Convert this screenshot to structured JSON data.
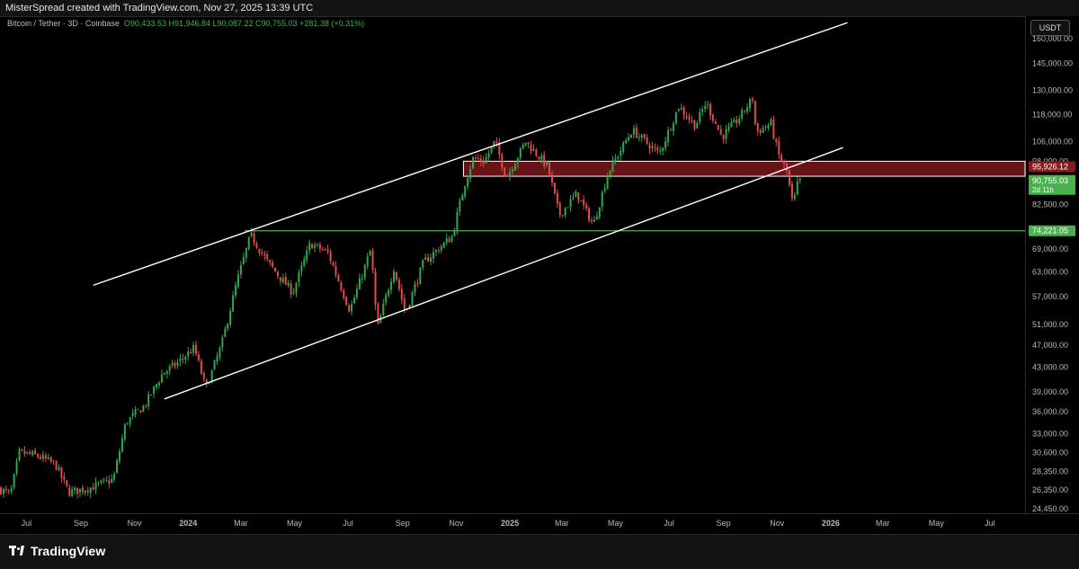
{
  "header": {
    "attribution": "MisterSpread created with TradingView.com, Nov 27, 2025 13:39 UTC",
    "symbol": "Bitcoin / Tether · 3D · Coinbase",
    "ohlc": "O90,433.53 H91,946.84 L90,087.22 C90,755.03 +281.38 (+0.31%)",
    "currency": "USDT"
  },
  "footer": {
    "brand": "TradingView"
  },
  "colors": {
    "up": "#2fa84f",
    "down": "#e04b4b",
    "zone": "#8a1a1f",
    "support": "#4caf50",
    "channel": "#ffffff",
    "axis_text": "#b9b9b9"
  },
  "chart_data": {
    "type": "line",
    "subtype": "candlestick with drawn channel",
    "title": "",
    "xlabel": "",
    "ylabel": "",
    "y_scale": "log",
    "ylim": [
      24000,
      175000
    ],
    "xlim": [
      "2023-06-01",
      "2026-08-10"
    ],
    "x_ticks": [
      {
        "date": "2023-07-01",
        "label": "Jul"
      },
      {
        "date": "2023-09-01",
        "label": "Sep"
      },
      {
        "date": "2023-11-01",
        "label": "Nov"
      },
      {
        "date": "2024-01-01",
        "label": "2024"
      },
      {
        "date": "2024-03-01",
        "label": "Mar"
      },
      {
        "date": "2024-05-01",
        "label": "May"
      },
      {
        "date": "2024-07-01",
        "label": "Jul"
      },
      {
        "date": "2024-09-01",
        "label": "Sep"
      },
      {
        "date": "2024-11-01",
        "label": "Nov"
      },
      {
        "date": "2025-01-01",
        "label": "2025"
      },
      {
        "date": "2025-03-01",
        "label": "Mar"
      },
      {
        "date": "2025-05-01",
        "label": "May"
      },
      {
        "date": "2025-07-01",
        "label": "Jul"
      },
      {
        "date": "2025-09-01",
        "label": "Sep"
      },
      {
        "date": "2025-11-01",
        "label": "Nov"
      },
      {
        "date": "2026-01-01",
        "label": "2026"
      },
      {
        "date": "2026-03-01",
        "label": "Mar"
      },
      {
        "date": "2026-05-01",
        "label": "May"
      },
      {
        "date": "2026-07-01",
        "label": "Jul"
      }
    ],
    "y_ticks": [
      {
        "value": 160000,
        "label": "160,000.00"
      },
      {
        "value": 145000,
        "label": "145,000.00"
      },
      {
        "value": 130000,
        "label": "130,000.00"
      },
      {
        "value": 118000,
        "label": "118,000.00"
      },
      {
        "value": 106000,
        "label": "106,000.00"
      },
      {
        "value": 98000,
        "label": "98,000.00"
      },
      {
        "value": 82500,
        "label": "82,500.00"
      },
      {
        "value": 69000,
        "label": "69,000.00"
      },
      {
        "value": 63000,
        "label": "63,000.00"
      },
      {
        "value": 57000,
        "label": "57,000.00"
      },
      {
        "value": 51000,
        "label": "51,000.00"
      },
      {
        "value": 47000,
        "label": "47,000.00"
      },
      {
        "value": 43000,
        "label": "43,000.00"
      },
      {
        "value": 39000,
        "label": "39,000.00"
      },
      {
        "value": 36000,
        "label": "36,000.00"
      },
      {
        "value": 33000,
        "label": "33,000.00"
      },
      {
        "value": 30600,
        "label": "30,600.00"
      },
      {
        "value": 28350,
        "label": "28,350.00"
      },
      {
        "value": 26350,
        "label": "26,350.00"
      },
      {
        "value": 24450,
        "label": "24,450.00"
      }
    ],
    "price_labels": [
      {
        "value": 95926.12,
        "label": "95,926.12",
        "style": "zone"
      },
      {
        "value": 90755.03,
        "label": "90,755.03",
        "sub": "2d 11h",
        "style": "last"
      },
      {
        "value": 74221.05,
        "label": "74,221.05",
        "style": "support"
      }
    ],
    "zone": {
      "start": "2024-11-01",
      "end": "2026-08-10",
      "top": 98000,
      "bottom": 92300
    },
    "support_line": {
      "start": "2024-03-05",
      "end": "2026-08-10",
      "value": 74221.05
    },
    "channel_lines": [
      {
        "start": {
          "date": "2023-09-15",
          "price": 59700
        },
        "end": {
          "date": "2026-01-20",
          "price": 170500
        }
      },
      {
        "start": {
          "date": "2023-12-05",
          "price": 37900
        },
        "end": {
          "date": "2026-01-15",
          "price": 103500
        }
      }
    ],
    "price_path": [
      {
        "date": "2023-06-01",
        "price": 26500
      },
      {
        "date": "2023-06-15",
        "price": 25900
      },
      {
        "date": "2023-06-25",
        "price": 30600
      },
      {
        "date": "2023-07-15",
        "price": 30200
      },
      {
        "date": "2023-08-05",
        "price": 29200
      },
      {
        "date": "2023-08-20",
        "price": 26100
      },
      {
        "date": "2023-09-15",
        "price": 26600
      },
      {
        "date": "2023-10-10",
        "price": 27500
      },
      {
        "date": "2023-10-24",
        "price": 34500
      },
      {
        "date": "2023-11-15",
        "price": 37000
      },
      {
        "date": "2023-12-05",
        "price": 42000
      },
      {
        "date": "2023-12-20",
        "price": 43500
      },
      {
        "date": "2024-01-10",
        "price": 46500
      },
      {
        "date": "2024-01-23",
        "price": 39500
      },
      {
        "date": "2024-02-10",
        "price": 47000
      },
      {
        "date": "2024-02-28",
        "price": 61000
      },
      {
        "date": "2024-03-14",
        "price": 73000
      },
      {
        "date": "2024-04-01",
        "price": 66000
      },
      {
        "date": "2024-04-15",
        "price": 62000
      },
      {
        "date": "2024-05-01",
        "price": 58000
      },
      {
        "date": "2024-05-21",
        "price": 70500
      },
      {
        "date": "2024-06-10",
        "price": 68000
      },
      {
        "date": "2024-07-05",
        "price": 54000
      },
      {
        "date": "2024-07-29",
        "price": 69000
      },
      {
        "date": "2024-08-05",
        "price": 50000
      },
      {
        "date": "2024-08-24",
        "price": 64000
      },
      {
        "date": "2024-09-06",
        "price": 53500
      },
      {
        "date": "2024-09-27",
        "price": 65500
      },
      {
        "date": "2024-10-29",
        "price": 72500
      },
      {
        "date": "2024-11-13",
        "price": 90000
      },
      {
        "date": "2024-11-22",
        "price": 99000
      },
      {
        "date": "2024-12-05",
        "price": 98000
      },
      {
        "date": "2024-12-17",
        "price": 106000
      },
      {
        "date": "2024-12-30",
        "price": 92000
      },
      {
        "date": "2025-01-21",
        "price": 106000
      },
      {
        "date": "2025-02-15",
        "price": 96000
      },
      {
        "date": "2025-02-28",
        "price": 79000
      },
      {
        "date": "2025-03-20",
        "price": 86000
      },
      {
        "date": "2025-04-08",
        "price": 76000
      },
      {
        "date": "2025-04-25",
        "price": 94000
      },
      {
        "date": "2025-05-22",
        "price": 111000
      },
      {
        "date": "2025-06-22",
        "price": 101000
      },
      {
        "date": "2025-07-14",
        "price": 122000
      },
      {
        "date": "2025-08-02",
        "price": 113000
      },
      {
        "date": "2025-08-14",
        "price": 124000
      },
      {
        "date": "2025-09-01",
        "price": 108000
      },
      {
        "date": "2025-09-20",
        "price": 116000
      },
      {
        "date": "2025-10-06",
        "price": 126000
      },
      {
        "date": "2025-10-10",
        "price": 110000
      },
      {
        "date": "2025-10-27",
        "price": 114000
      },
      {
        "date": "2025-11-04",
        "price": 101000
      },
      {
        "date": "2025-11-14",
        "price": 94000
      },
      {
        "date": "2025-11-21",
        "price": 82000
      },
      {
        "date": "2025-11-27",
        "price": 90755
      }
    ]
  }
}
